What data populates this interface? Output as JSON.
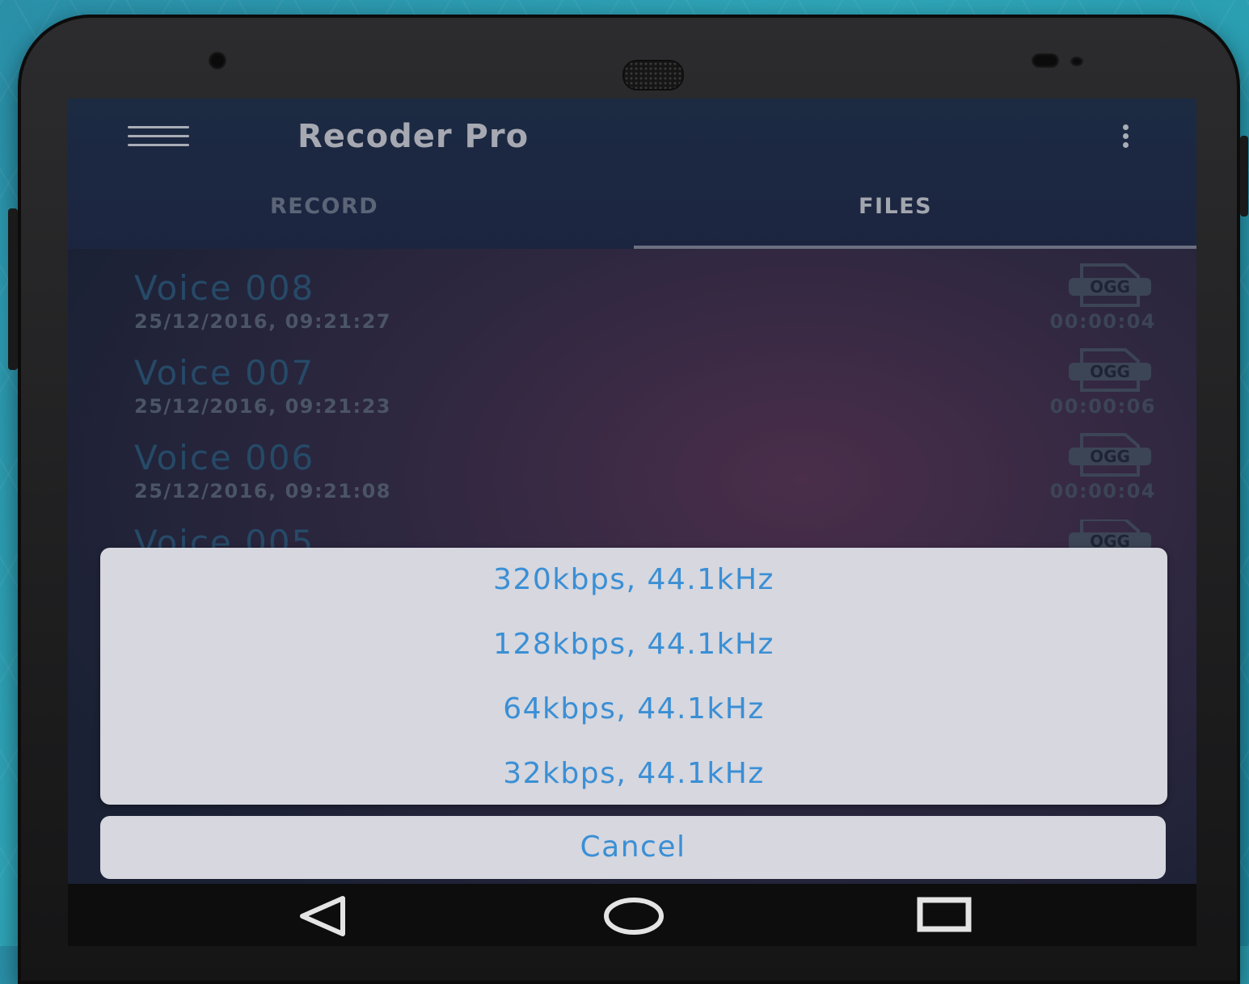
{
  "appbar": {
    "title": "Recoder Pro"
  },
  "tabs": [
    {
      "label": "RECORD"
    },
    {
      "label": "FILES"
    }
  ],
  "files": [
    {
      "name": "Voice 008",
      "date": "25/12/2016, 09:21:27",
      "duration": "00:00:04",
      "format": "OGG"
    },
    {
      "name": "Voice 007",
      "date": "25/12/2016, 09:21:23",
      "duration": "00:00:06",
      "format": "OGG"
    },
    {
      "name": "Voice 006",
      "date": "25/12/2016, 09:21:08",
      "duration": "00:00:04",
      "format": "OGG"
    },
    {
      "name": "Voice 005",
      "format": "OGG"
    }
  ],
  "sheet": {
    "options": [
      {
        "label": "320kbps, 44.1kHz"
      },
      {
        "label": "128kbps, 44.1kHz"
      },
      {
        "label": "64kbps, 44.1kHz"
      },
      {
        "label": "32kbps, 44.1kHz"
      }
    ],
    "cancel_label": "Cancel"
  },
  "colors": {
    "accent": "#3a8fd5",
    "sheet_bg": "#d6d7df",
    "appbar_bg": "#1c2a42"
  }
}
